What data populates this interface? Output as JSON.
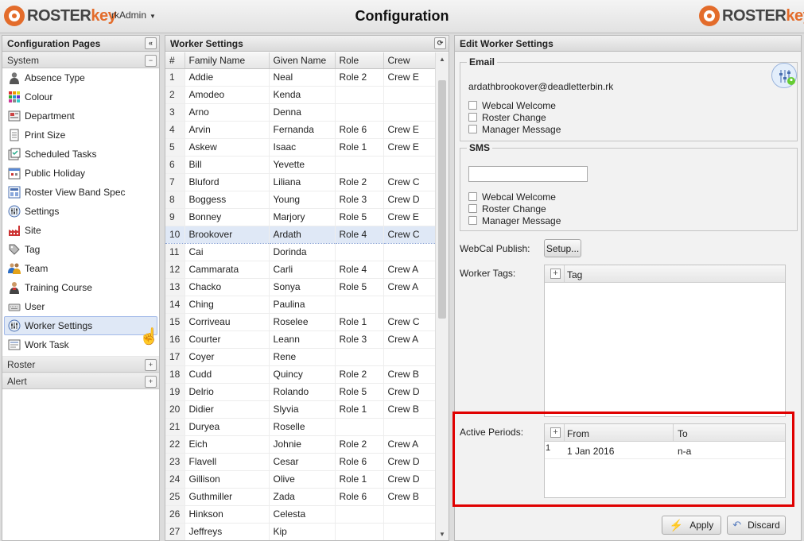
{
  "header": {
    "brand_left_a": "ROSTER",
    "brand_left_b": "key",
    "user": "rkAdmin",
    "title": "Configuration",
    "brand_right_a": "ROSTER",
    "brand_right_b": "key"
  },
  "colors": {
    "accent": "#e36c2b",
    "selection": "#dfe8f6",
    "highlight_box": "#e00000"
  },
  "nav": {
    "title": "Configuration Pages",
    "collapse_icon": "double-chevron-left-icon",
    "system_label": "System",
    "items": [
      {
        "label": "Absence Type",
        "icon": "person-icon"
      },
      {
        "label": "Colour",
        "icon": "color-grid-icon"
      },
      {
        "label": "Department",
        "icon": "department-icon"
      },
      {
        "label": "Print Size",
        "icon": "page-icon"
      },
      {
        "label": "Scheduled Tasks",
        "icon": "tasks-icon"
      },
      {
        "label": "Public Holiday",
        "icon": "calendar-icon"
      },
      {
        "label": "Roster View Band Spec",
        "icon": "band-icon"
      },
      {
        "label": "Settings",
        "icon": "settings-icon"
      },
      {
        "label": "Site",
        "icon": "factory-icon"
      },
      {
        "label": "Tag",
        "icon": "tag-icon"
      },
      {
        "label": "Team",
        "icon": "team-icon"
      },
      {
        "label": "Training Course",
        "icon": "teacher-icon"
      },
      {
        "label": "User",
        "icon": "keyboard-icon"
      },
      {
        "label": "Worker Settings",
        "icon": "worker-settings-icon"
      },
      {
        "label": "Work Task",
        "icon": "worktask-icon"
      }
    ],
    "roster_label": "Roster",
    "alert_label": "Alert"
  },
  "workers": {
    "title": "Worker Settings",
    "columns": [
      "#",
      "Family Name",
      "Given Name",
      "Role",
      "Crew"
    ],
    "rows": [
      [
        "1",
        "Addie",
        "Neal",
        "Role 2",
        "Crew E"
      ],
      [
        "2",
        "Amodeo",
        "Kenda",
        "",
        ""
      ],
      [
        "3",
        "Arno",
        "Denna",
        "",
        ""
      ],
      [
        "4",
        "Arvin",
        "Fernanda",
        "Role 6",
        "Crew E"
      ],
      [
        "5",
        "Askew",
        "Isaac",
        "Role 1",
        "Crew E"
      ],
      [
        "6",
        "Bill",
        "Yevette",
        "",
        ""
      ],
      [
        "7",
        "Bluford",
        "Liliana",
        "Role 2",
        "Crew C"
      ],
      [
        "8",
        "Boggess",
        "Young",
        "Role 3",
        "Crew D"
      ],
      [
        "9",
        "Bonney",
        "Marjory",
        "Role 5",
        "Crew E"
      ],
      [
        "10",
        "Brookover",
        "Ardath",
        "Role 4",
        "Crew C"
      ],
      [
        "11",
        "Cai",
        "Dorinda",
        "",
        ""
      ],
      [
        "12",
        "Cammarata",
        "Carli",
        "Role 4",
        "Crew A"
      ],
      [
        "13",
        "Chacko",
        "Sonya",
        "Role 5",
        "Crew A"
      ],
      [
        "14",
        "Ching",
        "Paulina",
        "",
        ""
      ],
      [
        "15",
        "Corriveau",
        "Roselee",
        "Role 1",
        "Crew C"
      ],
      [
        "16",
        "Courter",
        "Leann",
        "Role 3",
        "Crew A"
      ],
      [
        "17",
        "Coyer",
        "Rene",
        "",
        ""
      ],
      [
        "18",
        "Cudd",
        "Quincy",
        "Role 2",
        "Crew B"
      ],
      [
        "19",
        "Delrio",
        "Rolando",
        "Role 5",
        "Crew D"
      ],
      [
        "20",
        "Didier",
        "Slyvia",
        "Role 1",
        "Crew B"
      ],
      [
        "21",
        "Duryea",
        "Roselle",
        "",
        ""
      ],
      [
        "22",
        "Eich",
        "Johnie",
        "Role 2",
        "Crew A"
      ],
      [
        "23",
        "Flavell",
        "Cesar",
        "Role 6",
        "Crew D"
      ],
      [
        "24",
        "Gillison",
        "Olive",
        "Role 1",
        "Crew D"
      ],
      [
        "25",
        "Guthmiller",
        "Zada",
        "Role 6",
        "Crew B"
      ],
      [
        "26",
        "Hinkson",
        "Celesta",
        "",
        ""
      ],
      [
        "27",
        "Jeffreys",
        "Kip",
        "",
        ""
      ]
    ],
    "selected_row": "10"
  },
  "edit": {
    "title": "Edit Worker Settings",
    "email_legend": "Email",
    "email_value": "ardathbrookover@deadletterbin.rk",
    "email_checks": [
      "Webcal Welcome",
      "Roster Change",
      "Manager Message"
    ],
    "sms_legend": "SMS",
    "sms_value": "",
    "sms_checks": [
      "Webcal Welcome",
      "Roster Change",
      "Manager Message"
    ],
    "webcal_label": "WebCal Publish:",
    "setup_button": "Setup...",
    "tags_label": "Worker Tags:",
    "tags_column": "Tag",
    "periods_label": "Active Periods:",
    "periods_columns": [
      "From",
      "To"
    ],
    "periods_rows": [
      [
        "1",
        "1 Jan 2016",
        "n-a"
      ]
    ],
    "apply_button": "Apply",
    "discard_button": "Discard"
  }
}
